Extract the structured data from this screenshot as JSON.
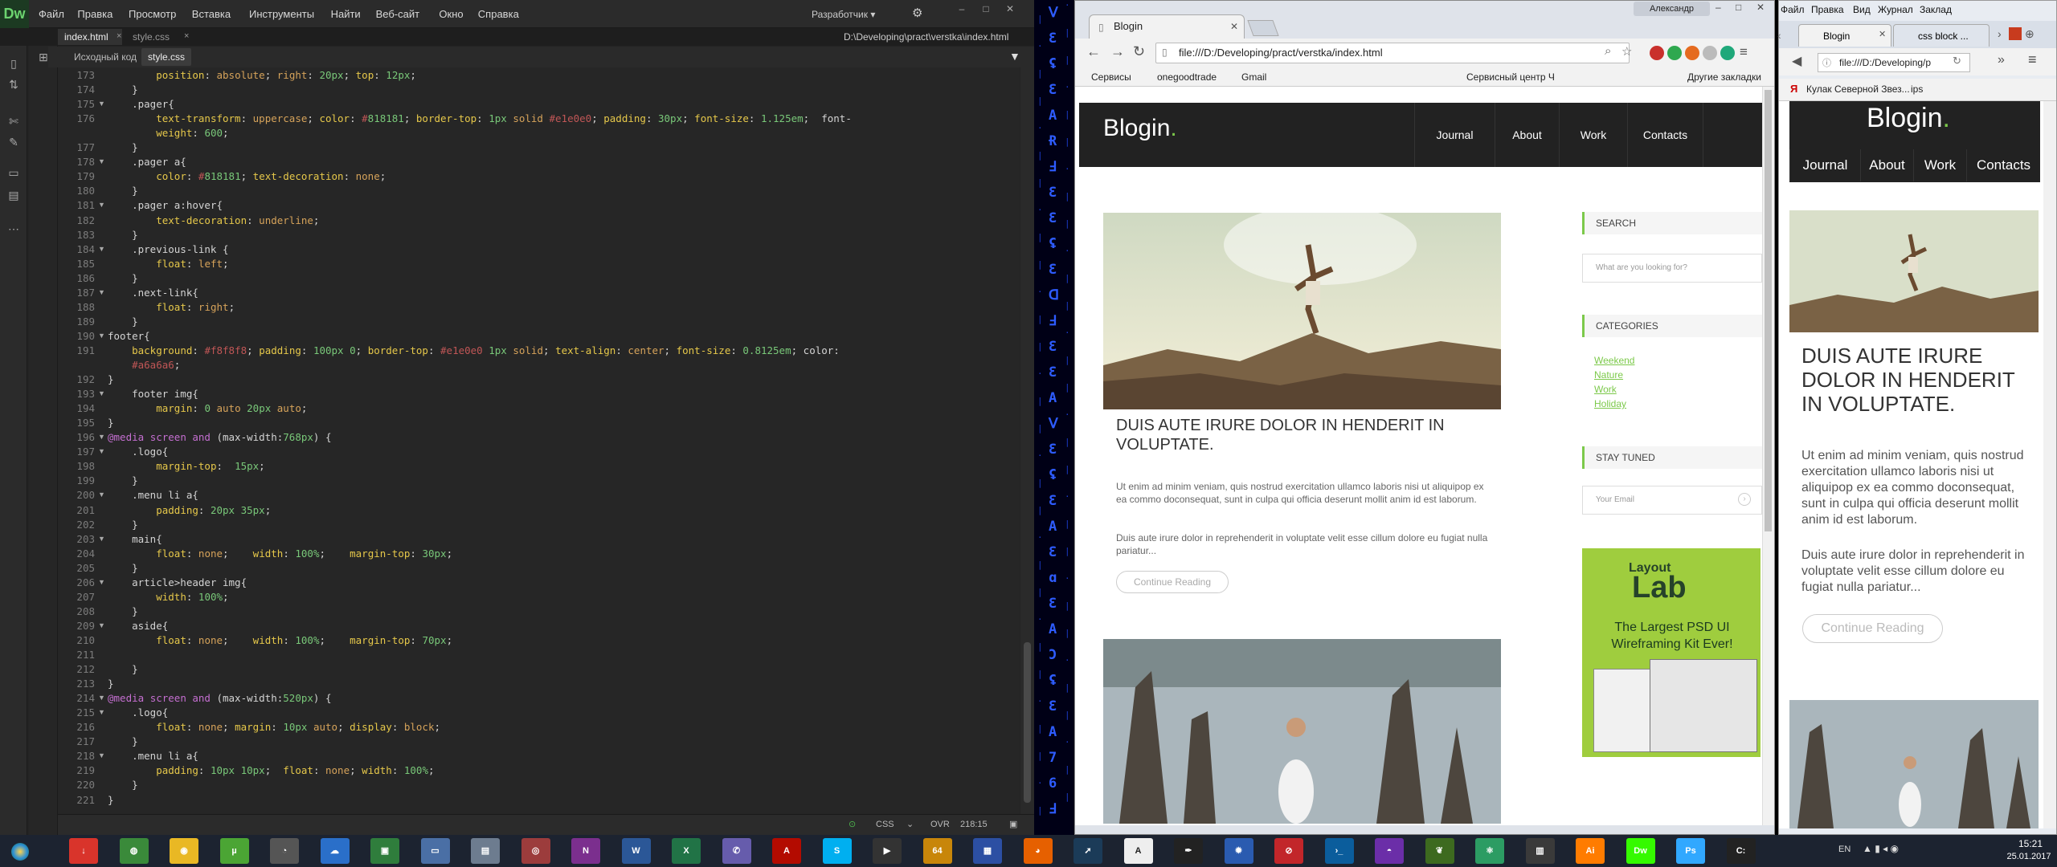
{
  "dreamweaver": {
    "logo": "Dw",
    "menu": [
      "Файл",
      "Правка",
      "Просмотр",
      "Вставка",
      "Инструменты",
      "Найти",
      "Веб-сайт",
      "Окно",
      "Справка"
    ],
    "workspace": "Разработчик ▾",
    "tabs": [
      "index.html",
      "style.css"
    ],
    "path": "D:\\Developing\\pract\\verstka\\index.html",
    "related": {
      "source": "Исходный код",
      "css": "style.css"
    },
    "status": {
      "lang": "CSS",
      "mode": "OVR",
      "position": "218:15"
    }
  },
  "code_lines": [
    {
      "n": "173",
      "c": "        position: absolute; right: 20px; top: 12px;"
    },
    {
      "n": "174",
      "c": "    }"
    },
    {
      "n": "175",
      "c": "    .pager{",
      "f": true
    },
    {
      "n": "176",
      "c": "        text-transform: uppercase; color: #818181; border-top: 1px solid #e1e0e0; padding: 30px; font-size: 1.125em;  font-"
    },
    {
      "n": "",
      "c": "        weight: 600;"
    },
    {
      "n": "177",
      "c": "    }"
    },
    {
      "n": "178",
      "c": "    .pager a{",
      "f": true
    },
    {
      "n": "179",
      "c": "        color: #818181; text-decoration: none;"
    },
    {
      "n": "180",
      "c": "    }"
    },
    {
      "n": "181",
      "c": "    .pager a:hover{",
      "f": true
    },
    {
      "n": "182",
      "c": "        text-decoration: underline;"
    },
    {
      "n": "183",
      "c": "    }"
    },
    {
      "n": "184",
      "c": "    .previous-link {",
      "f": true
    },
    {
      "n": "185",
      "c": "        float: left;"
    },
    {
      "n": "186",
      "c": "    }"
    },
    {
      "n": "187",
      "c": "    .next-link{",
      "f": true
    },
    {
      "n": "188",
      "c": "        float: right;"
    },
    {
      "n": "189",
      "c": "    }"
    },
    {
      "n": "190",
      "c": "footer{",
      "f": true
    },
    {
      "n": "191",
      "c": "    background: #f8f8f8; padding: 100px 0; border-top: #e1e0e0 1px solid; text-align: center; font-size: 0.8125em; color:"
    },
    {
      "n": "",
      "c": "    #a6a6a6;"
    },
    {
      "n": "192",
      "c": "}"
    },
    {
      "n": "193",
      "c": "    footer img{",
      "f": true
    },
    {
      "n": "194",
      "c": "        margin: 0 auto 20px auto;"
    },
    {
      "n": "195",
      "c": "}"
    },
    {
      "n": "196",
      "c": "@media screen and (max-width:768px) {",
      "f": true
    },
    {
      "n": "197",
      "c": "    .logo{",
      "f": true
    },
    {
      "n": "198",
      "c": "        margin-top:  15px;"
    },
    {
      "n": "199",
      "c": "    }"
    },
    {
      "n": "200",
      "c": "    .menu li a{",
      "f": true
    },
    {
      "n": "201",
      "c": "        padding: 20px 35px;"
    },
    {
      "n": "202",
      "c": "    }"
    },
    {
      "n": "203",
      "c": "    main{",
      "f": true
    },
    {
      "n": "204",
      "c": "        float: none;    width: 100%;    margin-top: 30px;"
    },
    {
      "n": "205",
      "c": "    }"
    },
    {
      "n": "206",
      "c": "    article>header img{",
      "f": true
    },
    {
      "n": "207",
      "c": "        width: 100%;"
    },
    {
      "n": "208",
      "c": "    }"
    },
    {
      "n": "209",
      "c": "    aside{",
      "f": true
    },
    {
      "n": "210",
      "c": "        float: none;    width: 100%;    margin-top: 70px;"
    },
    {
      "n": "211",
      "c": ""
    },
    {
      "n": "212",
      "c": "    }"
    },
    {
      "n": "213",
      "c": "}"
    },
    {
      "n": "214",
      "c": "@media screen and (max-width:520px) {",
      "f": true
    },
    {
      "n": "215",
      "c": "    .logo{",
      "f": true
    },
    {
      "n": "216",
      "c": "        float: none; margin: 10px auto; display: block;"
    },
    {
      "n": "217",
      "c": "    }"
    },
    {
      "n": "218",
      "c": "    .menu li a{",
      "f": true
    },
    {
      "n": "219",
      "c": "        padding: 10px 10px;  float: none; width: 100%;"
    },
    {
      "n": "220",
      "c": "    }"
    },
    {
      "n": "221",
      "c": "}"
    }
  ],
  "matrix": [
    "Ⅴ",
    "Ɛ",
    "ʢ",
    "Ɛ",
    "A",
    "Ɍ",
    "Ⅎ",
    "Ɛ",
    "Ɛ",
    "ʢ",
    "Ɛ",
    "ᗡ",
    "Ⅎ",
    "Ɛ",
    "Ɛ",
    "A",
    "Ⅴ",
    "Ɛ",
    "ʢ",
    "Ɛ",
    "A",
    "Ɛ",
    "ɑ",
    "Ɛ",
    "A",
    "Ɔ",
    "ʢ",
    "Ɛ",
    "A",
    "7",
    "6",
    "Ⅎ"
  ],
  "chrome": {
    "tab_title": "Blogin",
    "user": "Александр",
    "url": "file:///D:/Developing/pract/verstka/index.html",
    "bookmarks": [
      "Сервисы",
      "onegoodtrade",
      "Gmail",
      "Сервисный центр Ч",
      "Другие закладки"
    ]
  },
  "blog": {
    "logo": "Blogin",
    "logo_dot": ".",
    "nav": [
      "Journal",
      "About",
      "Work",
      "Contacts"
    ],
    "post_title": "DUIS AUTE IRURE DOLOR IN HENDERIT IN VOLUPTATE.",
    "post_p1": "Ut enim ad minim veniam, quis nostrud exercitation ullamco laboris nisi ut aliquipop ex ea commo doconsequat, sunt in culpa qui officia deserunt mollit anim id est laborum.",
    "post_p2": "Duis aute irure dolor in reprehenderit in voluptate velit esse cillum dolore eu fugiat nulla pariatur...",
    "continue": "Continue Reading",
    "search_head": "SEARCH",
    "search_placeholder": "What are you looking for?",
    "categories_head": "CATEGORIES",
    "categories": [
      "Weekend",
      "Nature",
      "Work",
      "Holiday"
    ],
    "stay_head": "STAY TUNED",
    "email_placeholder": "Your Email",
    "ad_brand": "Layout",
    "ad_brand2": "Lab",
    "ad_text": "The Largest PSD UI Wireframing Kit Ever!"
  },
  "firefox": {
    "menu": [
      "Файл",
      "Правка",
      "Вид",
      "Журнал",
      "Заклад"
    ],
    "tabs": [
      "Blogin",
      "css block ..."
    ],
    "url": "file:///D:/Developing/p",
    "bookmark": "Кулак Северной Звез...",
    "bookmark2": "ips",
    "post_p1": "Ut enim ad minim veniam, quis nostrud exercitation ullamco laboris nisi ut aliquipop ex ea commo doconsequat, sunt in culpa qui officia deserunt mollit anim id est laborum.",
    "post_p2": "Duis aute irure dolor in reprehenderit in voluptate velit esse cillum dolore eu fugiat nulla pariatur..."
  },
  "taskbar": {
    "apps": [
      {
        "name": "download",
        "c": "#d9342b",
        "g": "↓"
      },
      {
        "name": "globe",
        "c": "#3a8a3a",
        "g": "◍"
      },
      {
        "name": "chrome",
        "c": "#e9b824",
        "g": "◉"
      },
      {
        "name": "utorrent",
        "c": "#4ba534",
        "g": "µ"
      },
      {
        "name": "dial",
        "c": "#555",
        "g": "◔"
      },
      {
        "name": "cloud",
        "c": "#2a6fc9",
        "g": "☁"
      },
      {
        "name": "monitor",
        "c": "#2f7d3c",
        "g": "▣"
      },
      {
        "name": "laptop",
        "c": "#4a6fa5",
        "g": "▭"
      },
      {
        "name": "notepad",
        "c": "#6d7c8f",
        "g": "▤"
      },
      {
        "name": "eye",
        "c": "#9c3c3c",
        "g": "◎"
      },
      {
        "name": "onenote",
        "c": "#7b2f8e",
        "g": "N"
      },
      {
        "name": "word",
        "c": "#2b5797",
        "g": "W"
      },
      {
        "name": "excel",
        "c": "#217346",
        "g": "X"
      },
      {
        "name": "viber",
        "c": "#665cac",
        "g": "✆"
      },
      {
        "name": "pdf",
        "c": "#b30b00",
        "g": "A"
      },
      {
        "name": "skype",
        "c": "#00aff0",
        "g": "S"
      },
      {
        "name": "player",
        "c": "#333",
        "g": "▶"
      },
      {
        "name": "aida",
        "c": "#c8860a",
        "g": "64"
      },
      {
        "name": "save",
        "c": "#2c4fa3",
        "g": "▦"
      },
      {
        "name": "firefox",
        "c": "#e66000",
        "g": "◕"
      },
      {
        "name": "wire",
        "c": "#1b3b58",
        "g": "➚"
      },
      {
        "name": "font",
        "c": "#eee",
        "g": "A"
      },
      {
        "name": "pen",
        "c": "#222",
        "g": "✒"
      },
      {
        "name": "gear",
        "c": "#2a5bb0",
        "g": "✹"
      },
      {
        "name": "lastpass",
        "c": "#c2262a",
        "g": "⊘"
      },
      {
        "name": "console",
        "c": "#0b5d9c",
        "g": "›_"
      },
      {
        "name": "app",
        "c": "#6b2ea8",
        "g": "◓"
      },
      {
        "name": "leaf",
        "c": "#3d6a1f",
        "g": "❦"
      },
      {
        "name": "atom",
        "c": "#2c9c63",
        "g": "⚛"
      },
      {
        "name": "bag",
        "c": "#3a3a3a",
        "g": "▥"
      },
      {
        "name": "illustrator",
        "c": "#ff7c00",
        "g": "Ai"
      },
      {
        "name": "dreamweaver",
        "c": "#35fa00",
        "g": "Dw"
      },
      {
        "name": "photoshop",
        "c": "#31a8ff",
        "g": "Ps"
      },
      {
        "name": "cmd",
        "c": "#222",
        "g": "C:"
      }
    ],
    "lang": "EN",
    "time": "15:21",
    "date": "25.01.2017"
  },
  "colors": {
    "accent": "#7cc94a",
    "dw_green": "#6cd36f",
    "taskbar": "#1c2330"
  }
}
